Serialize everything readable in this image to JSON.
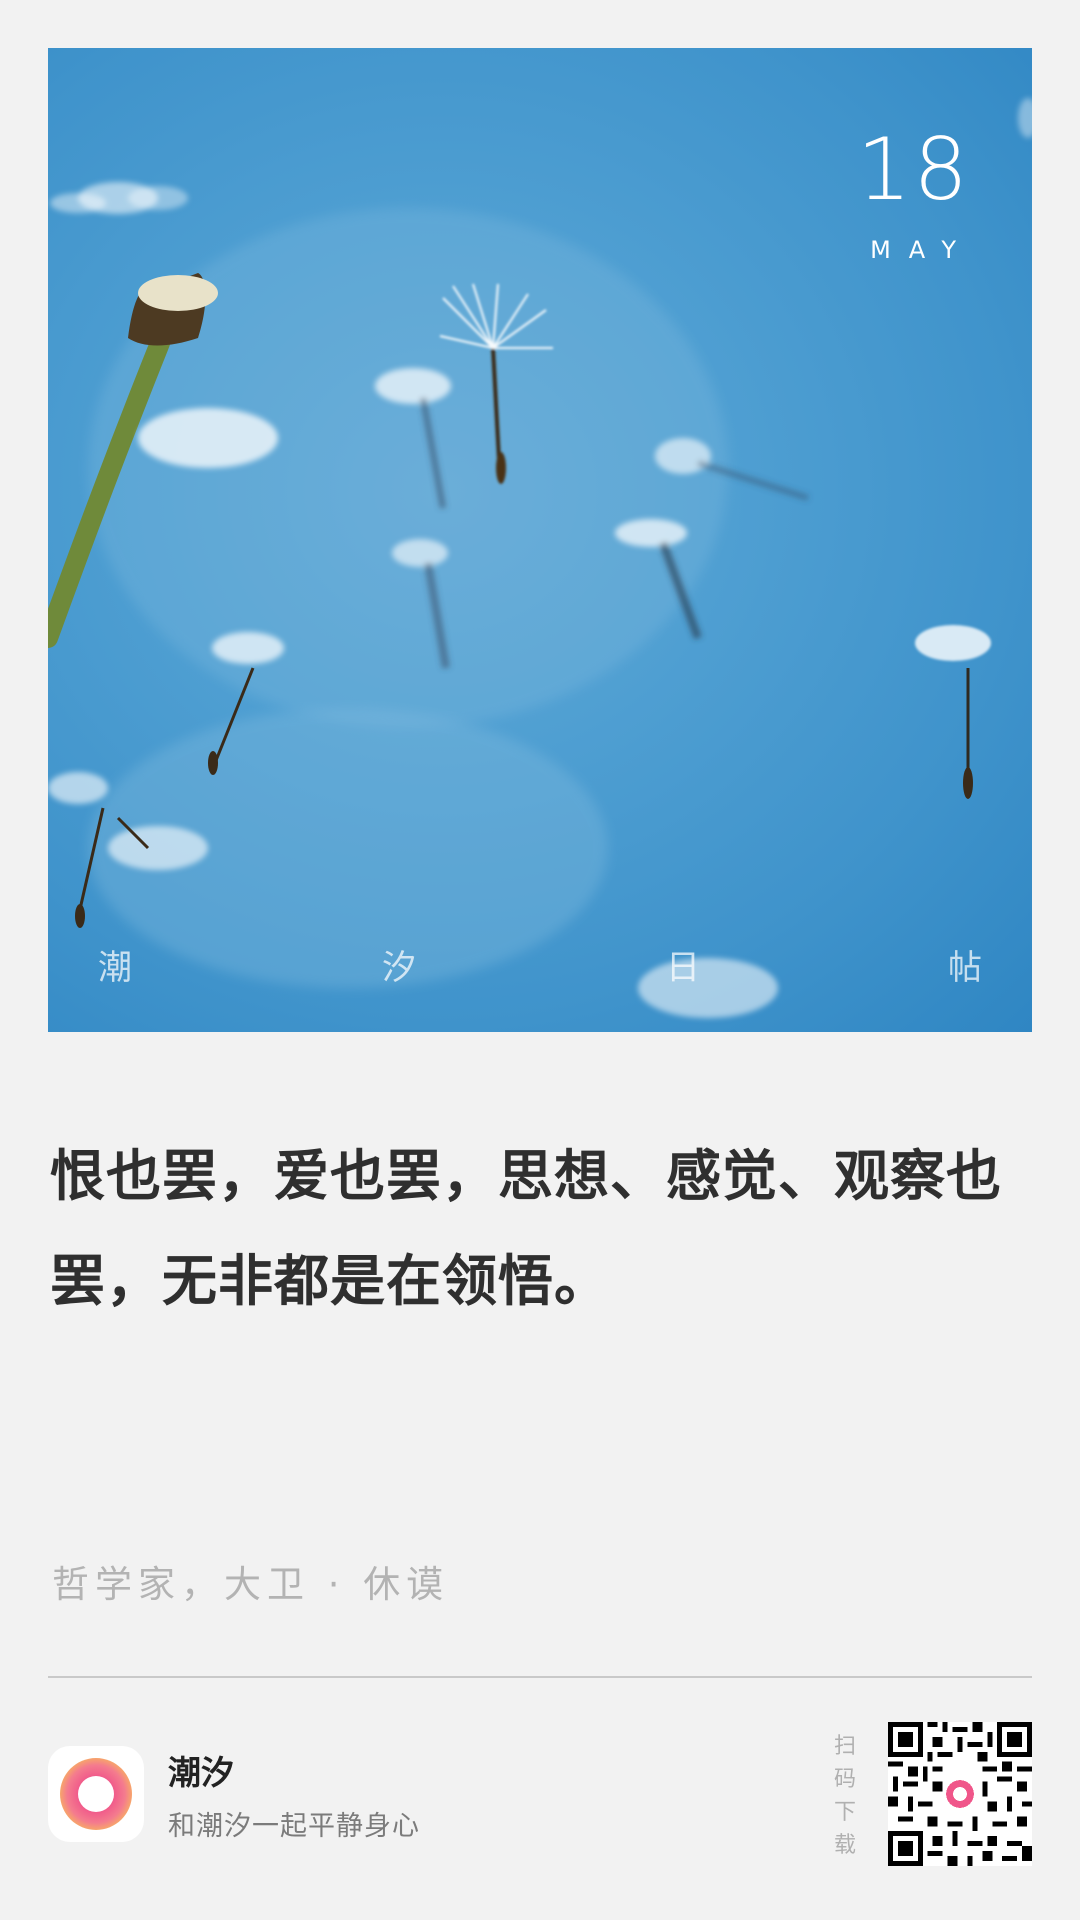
{
  "date": {
    "day": "18",
    "month": "MAY"
  },
  "brand_chars": [
    "潮",
    "汐",
    "日",
    "帖"
  ],
  "quote": "恨也罢，爱也罢，思想、感觉、观察也罢，无非都是在领悟。",
  "author": "哲学家，大卫 · 休谟",
  "app": {
    "name": "潮汐",
    "slogan": "和潮汐一起平静身心"
  },
  "scan_chars": [
    "扫",
    "码",
    "下",
    "载"
  ],
  "icons": {
    "app_logo": "tide-logo-icon",
    "qr_code": "qr-code-icon"
  },
  "colors": {
    "sky": "#4f9fd2",
    "background": "#f2f2f2",
    "quote_text": "#2f2f2f",
    "muted_text": "#b3b3b3",
    "logo_pink": "#f0568a",
    "logo_orange": "#f7a56b"
  }
}
